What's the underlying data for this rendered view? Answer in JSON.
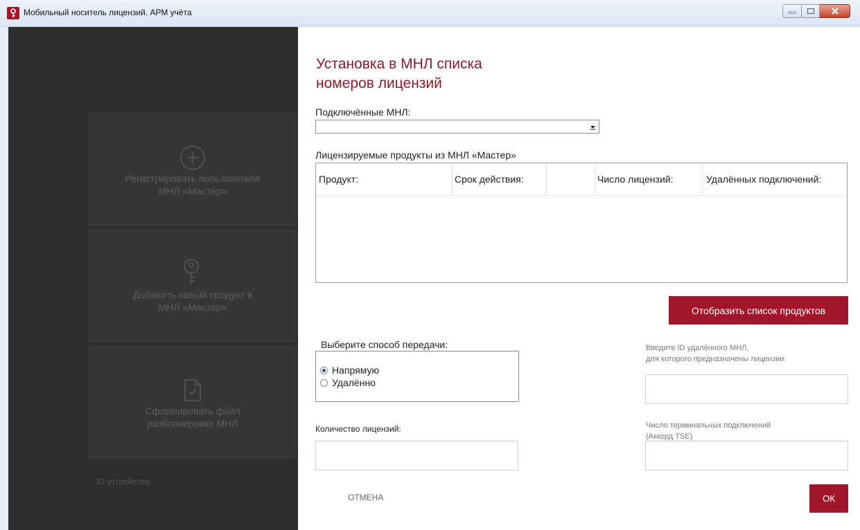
{
  "window": {
    "title": "Мобильный носитель лицензий. АРМ учёта"
  },
  "sidebar": {
    "tiles": [
      {
        "label_line1": "Регистрировать пользователя",
        "label_line2": "МНЛ «Мастер»",
        "icon": "plus-circle-icon"
      },
      {
        "label_line1": "Добавить новый продукт в",
        "label_line2": "МНЛ «Мастер»",
        "icon": "key-icon"
      },
      {
        "label_line1": "Сформировать файл",
        "label_line2": "разблокировки МНЛ",
        "icon": "document-check-icon"
      }
    ],
    "device_id_label": "ID устройства:"
  },
  "dialog": {
    "title_line1": "Установка в МНЛ списка",
    "title_line2": "номеров лицензий",
    "connected_label": "Подключённые МНЛ:",
    "connected_value": "",
    "products_label": "Лицензируемые продукты из МНЛ «Мастер»",
    "columns": [
      "Продукт:",
      "Срок действия:",
      "",
      "Число лицензий:",
      "Удалённых подключений:"
    ],
    "rows": [],
    "show_products_button": "Отобразить список продуктов",
    "transfer_label": "Выберите способ передачи:",
    "transfer_options": [
      {
        "label": "Напрямую",
        "selected": true
      },
      {
        "label": "Удалённо",
        "selected": false
      }
    ],
    "remote_id_label_line1": "Введите ID удалённого МНЛ,",
    "remote_id_label_line2": "для которого предназначены лицензии:",
    "remote_id_value": "",
    "license_count_label": "Количество  лицензий:",
    "license_count_value": "",
    "terminal_label_line1": "Число терминальных подключений",
    "terminal_label_line2": "(Аккорд TSE)",
    "terminal_value": "",
    "cancel_button": "ОТМЕНА",
    "ok_button": "ОК"
  },
  "colors": {
    "accent": "#a3152b",
    "title": "#8a1b2e",
    "sidebar_bg": "#2d2d2d"
  }
}
